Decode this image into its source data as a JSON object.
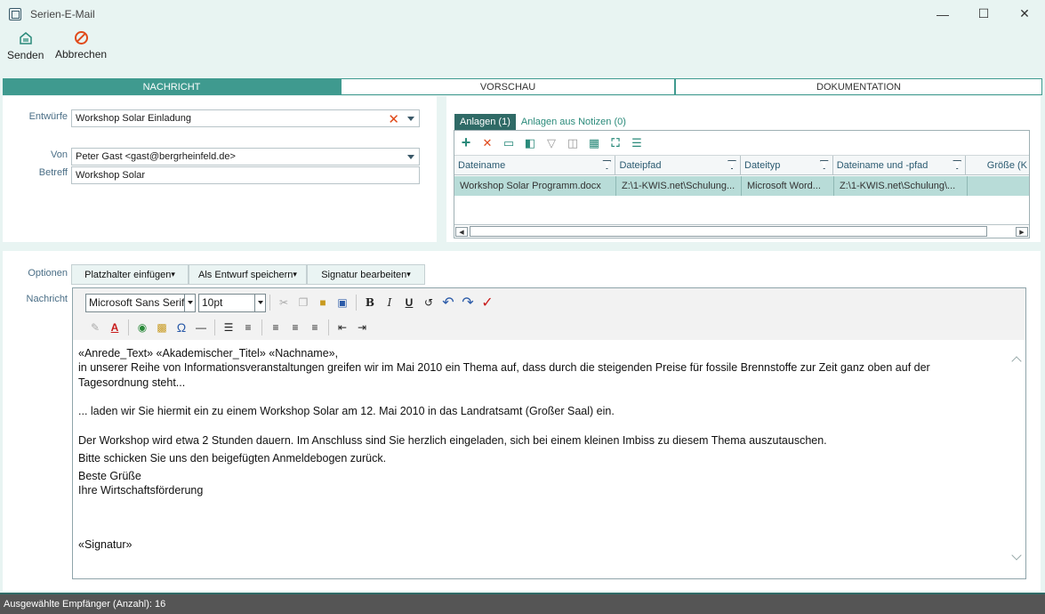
{
  "window": {
    "title": "Serien-E-Mail"
  },
  "ribbon": {
    "send_label": "Senden",
    "cancel_label": "Abbrechen"
  },
  "tabs": [
    {
      "label": "NACHRICHT",
      "active": true
    },
    {
      "label": "VORSCHAU",
      "active": false
    },
    {
      "label": "DOKUMENTATION",
      "active": false
    }
  ],
  "form": {
    "drafts_label": "Entwürfe",
    "drafts_value": "Workshop Solar Einladung",
    "from_label": "Von",
    "from_value": "Peter Gast <gast@bergrheinfeld.de>",
    "subject_label": "Betreff",
    "subject_value": "Workshop Solar"
  },
  "attachments": {
    "tab_attachments": "Anlagen (1)",
    "tab_from_notes": "Anlagen aus Notizen (0)",
    "columns": [
      "Dateiname",
      "Dateipfad",
      "Dateityp",
      "Dateiname und -pfad",
      "Größe (K"
    ],
    "rows": [
      [
        "Workshop Solar Programm.docx",
        "Z:\\1-KWIS.net\\Schulung...",
        "Microsoft Word...",
        "Z:\\1-KWIS.net\\Schulung\\..."
      ]
    ]
  },
  "options": {
    "options_label": "Optionen",
    "insert_placeholder": "Platzhalter einfügen",
    "save_as_draft": "Als Entwurf speichern",
    "edit_signature": "Signatur bearbeiten",
    "message_label": "Nachricht"
  },
  "editor": {
    "font": "Microsoft Sans Serif",
    "size": "10pt",
    "lines": [
      "«Anrede_Text» «Akademischer_Titel» «Nachname»,",
      "in unserer Reihe von Informationsveranstaltungen greifen wir im Mai 2010 ein Thema auf, dass durch die steigenden Preise für fossile Brennstoffe zur Zeit ganz oben auf der Tagesordnung steht...",
      "",
      "... laden wir Sie hiermit ein zu einem Workshop Solar am 12. Mai 2010 in das Landratsamt (Großer Saal) ein.",
      "",
      "Der Workshop wird etwa 2 Stunden dauern. Im Anschluss sind Sie herzlich eingeladen, sich bei einem kleinen Imbiss zu diesem Thema auszutauschen.",
      "Bitte schicken Sie uns den beigefügten Anmeldebogen zurück.",
      "Beste Grüße",
      "Ihre Wirtschaftsförderung",
      "",
      "",
      "«Signatur»"
    ]
  },
  "status": {
    "recipients": "Ausgewählte Empfänger (Anzahl): 16"
  },
  "colors": {
    "accent": "#3f9a8f",
    "background": "#e8f4f2",
    "danger": "#e04a1a"
  }
}
